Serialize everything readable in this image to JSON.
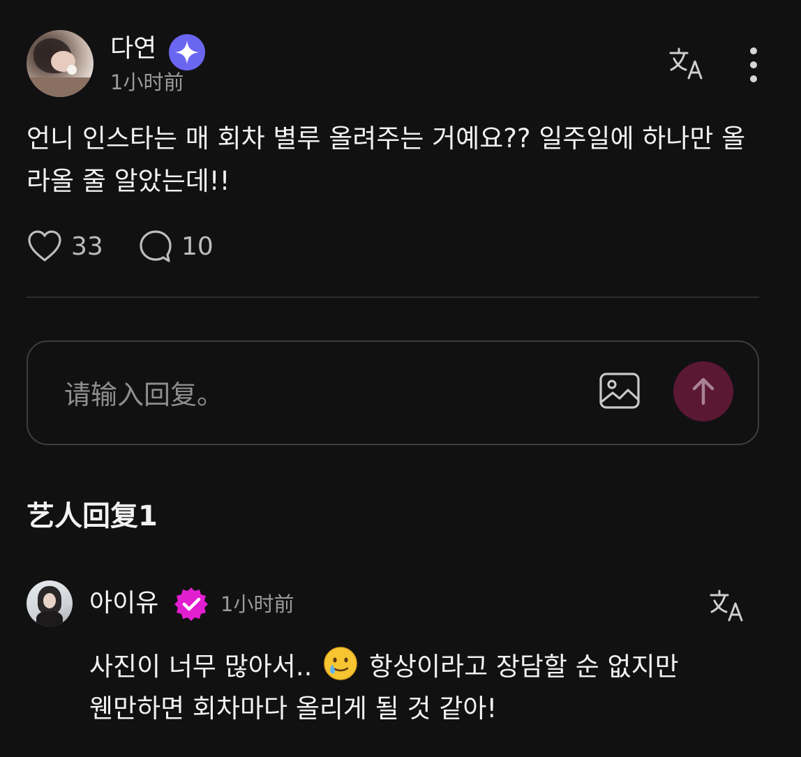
{
  "post": {
    "author_name": "다연",
    "time": "1小时前",
    "body": "언니 인스타는 매 회차 별루 올려주는 거예요?? 일주일에 하나만 올라올 줄 알았는데!!",
    "likes": "33",
    "comments": "10"
  },
  "reply_input": {
    "placeholder": "请输入回复。"
  },
  "section_title": "艺人回复1",
  "artist_reply": {
    "author_name": "아이유",
    "time": "1小时前",
    "body_line1_a": "사진이 너무 많아서..",
    "body_line1_b": "항상이라고 장담할 순 없지만",
    "body_line2": "웬만하면 회차마다 올리게 될 것 같아!"
  },
  "colors": {
    "background": "#121112",
    "verified_star": "#6b66f2",
    "artist_badge": "#e21fd0",
    "send_button": "#5a1833",
    "muted_text": "#9b9b9b"
  },
  "icons": [
    "verified-star-icon",
    "translate-icon",
    "more-icon",
    "heart-icon",
    "comment-icon",
    "image-icon",
    "send-arrow-icon",
    "artist-badge-icon",
    "tear-smile-emoji"
  ]
}
